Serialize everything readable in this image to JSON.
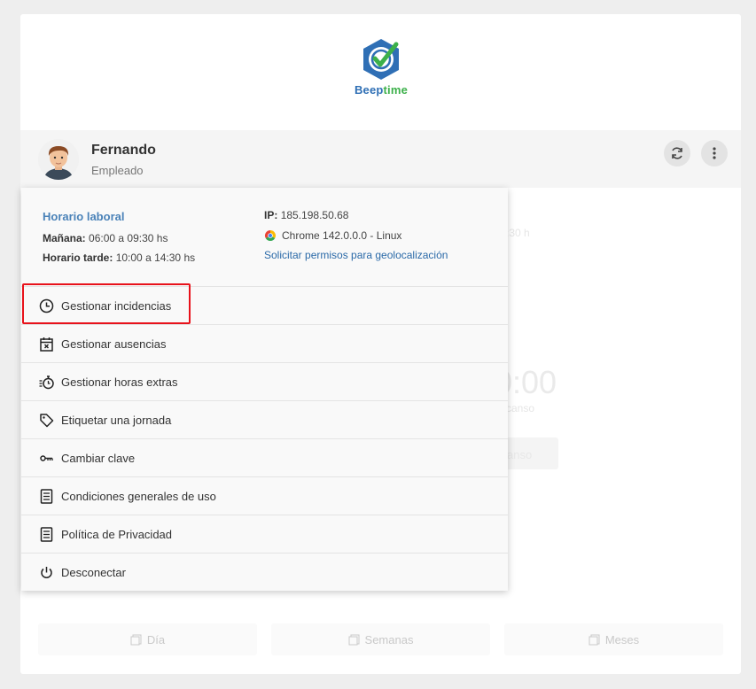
{
  "brand": {
    "name_part1": "Beep",
    "name_part2": "time"
  },
  "user": {
    "name": "Fernando",
    "role": "Empleado"
  },
  "schedule": {
    "title": "Horario laboral",
    "morning_label": "Mañana:",
    "morning_value": "06:00 a 09:30 hs",
    "afternoon_label": "Horario tarde:",
    "afternoon_value": "10:00 a 14:30 hs"
  },
  "system": {
    "ip_label": "IP:",
    "ip_value": "185.198.50.68",
    "browser": "Chrome 142.0.0.0 - Linux",
    "geo_link": "Solicitar permisos para geolocalización"
  },
  "menu": {
    "items": [
      {
        "label": "Gestionar incidencias",
        "icon": "clock-icon"
      },
      {
        "label": "Gestionar ausencias",
        "icon": "calendar-x-icon"
      },
      {
        "label": "Gestionar horas extras",
        "icon": "stopwatch-icon"
      },
      {
        "label": "Etiquetar una jornada",
        "icon": "tag-icon"
      },
      {
        "label": "Cambiar clave",
        "icon": "key-icon"
      },
      {
        "label": "Condiciones generales de uso",
        "icon": "document-icon"
      },
      {
        "label": "Política de Privacidad",
        "icon": "document-icon"
      },
      {
        "label": "Desconectar",
        "icon": "power-icon"
      }
    ]
  },
  "background": {
    "time_fragment": "0:00",
    "hours_fragment": ":30 h",
    "sub_fragment": "canso",
    "button_fragment": "anso"
  },
  "tabs": [
    {
      "label": "Día"
    },
    {
      "label": "Semanas"
    },
    {
      "label": "Meses"
    }
  ],
  "colors": {
    "accent_blue": "#2f6fb5",
    "accent_green": "#3cb04a",
    "highlight_red": "#e8121b",
    "link": "#2b6aa8"
  }
}
